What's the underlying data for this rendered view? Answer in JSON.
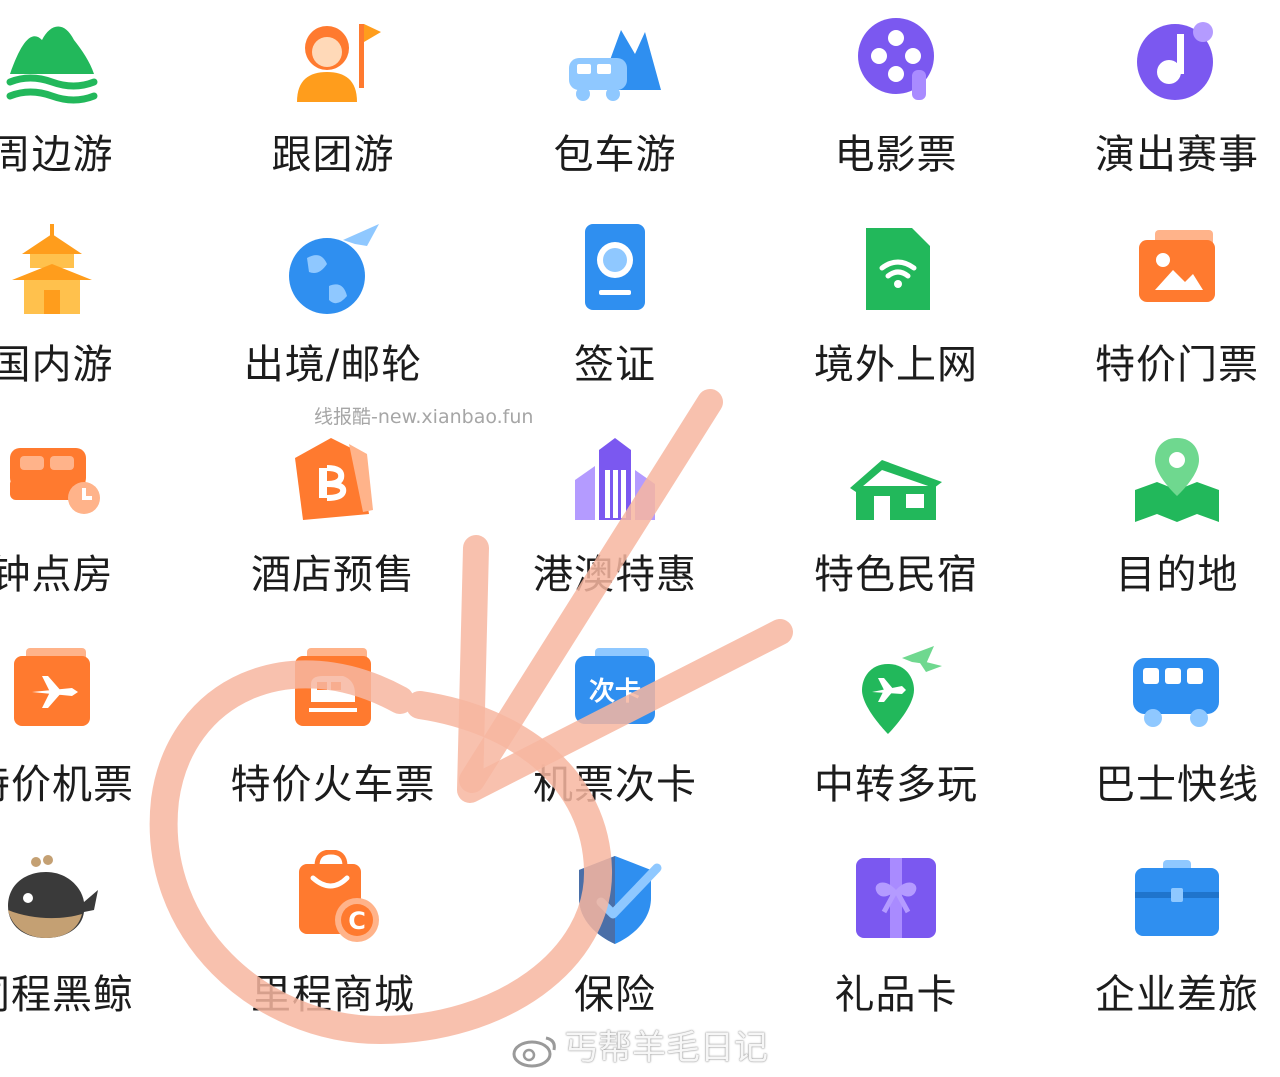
{
  "grid": {
    "rows": [
      [
        {
          "label": "周边游",
          "icon": "mountain-water-icon"
        },
        {
          "label": "跟团游",
          "icon": "guide-flag-icon"
        },
        {
          "label": "包车游",
          "icon": "car-mountain-icon"
        },
        {
          "label": "电影票",
          "icon": "film-reel-icon"
        },
        {
          "label": "演出赛事",
          "icon": "music-note-icon"
        }
      ],
      [
        {
          "label": "国内游",
          "icon": "pagoda-icon"
        },
        {
          "label": "出境/邮轮",
          "icon": "globe-plane-icon"
        },
        {
          "label": "签证",
          "icon": "passport-icon"
        },
        {
          "label": "境外上网",
          "icon": "sim-wifi-icon"
        },
        {
          "label": "特价门票",
          "icon": "ticket-picture-icon"
        }
      ],
      [
        {
          "label": "钟点房",
          "icon": "bed-clock-icon"
        },
        {
          "label": "酒店预售",
          "icon": "b-tag-icon"
        },
        {
          "label": "港澳特惠",
          "icon": "city-building-icon"
        },
        {
          "label": "特色民宿",
          "icon": "house-icon"
        },
        {
          "label": "目的地",
          "icon": "map-pin-icon"
        }
      ],
      [
        {
          "label": "特价机票",
          "icon": "plane-ticket-icon"
        },
        {
          "label": "特价火车票",
          "icon": "train-ticket-icon"
        },
        {
          "label": "机票次卡",
          "icon": "pass-card-icon"
        },
        {
          "label": "中转多玩",
          "icon": "transfer-pin-icon"
        },
        {
          "label": "巴士快线",
          "icon": "bus-icon"
        }
      ],
      [
        {
          "label": "同程黑鲸",
          "icon": "whale-icon"
        },
        {
          "label": "里程商城",
          "icon": "shopping-bag-icon"
        },
        {
          "label": "保险",
          "icon": "shield-check-icon"
        },
        {
          "label": "礼品卡",
          "icon": "gift-card-icon"
        },
        {
          "label": "企业差旅",
          "icon": "briefcase-icon"
        }
      ]
    ]
  },
  "watermark": "线报酷-new.xianbao.fun",
  "weibo_watermark": "丐帮羊毛日记",
  "colors": {
    "green": "#22b85b",
    "orange": "#ff7a2f",
    "blue": "#2f8ff0",
    "purple": "#7b58f0",
    "annotation": "#f7b6a0"
  }
}
